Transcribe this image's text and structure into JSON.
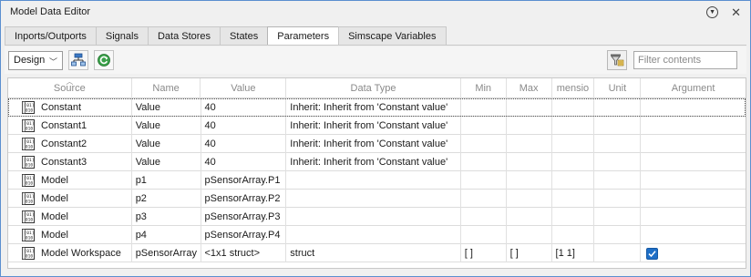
{
  "window": {
    "title": "Model Data Editor",
    "menu_icon": "circle-chevron-down-icon",
    "close_icon": "close-icon"
  },
  "tabs": [
    {
      "label": "Inports/Outports",
      "active": false
    },
    {
      "label": "Signals",
      "active": false
    },
    {
      "label": "Data Stores",
      "active": false
    },
    {
      "label": "States",
      "active": false
    },
    {
      "label": "Parameters",
      "active": true
    },
    {
      "label": "Simscape Variables",
      "active": false
    }
  ],
  "toolbar": {
    "view_select": "Design",
    "hierarchy_icon": "model-hierarchy-icon",
    "refresh_icon": "refresh-icon",
    "filter_icon": "filter-icon",
    "filter_placeholder": "Filter contents"
  },
  "columns": [
    "Source",
    "Name",
    "Value",
    "Data Type",
    "Min",
    "Max",
    "mensio",
    "Unit",
    "Argument"
  ],
  "rows": [
    {
      "source": "Constant",
      "name": "Value",
      "value": "40",
      "datatype": "Inherit: Inherit from 'Constant value'",
      "min": "",
      "max": "",
      "dim": "",
      "unit": "",
      "argument": false,
      "arg_shown": false,
      "selected": true
    },
    {
      "source": "Constant1",
      "name": "Value",
      "value": "40",
      "datatype": "Inherit: Inherit from 'Constant value'",
      "min": "",
      "max": "",
      "dim": "",
      "unit": "",
      "argument": false,
      "arg_shown": false,
      "selected": false
    },
    {
      "source": "Constant2",
      "name": "Value",
      "value": "40",
      "datatype": "Inherit: Inherit from 'Constant value'",
      "min": "",
      "max": "",
      "dim": "",
      "unit": "",
      "argument": false,
      "arg_shown": false,
      "selected": false
    },
    {
      "source": "Constant3",
      "name": "Value",
      "value": "40",
      "datatype": "Inherit: Inherit from 'Constant value'",
      "min": "",
      "max": "",
      "dim": "",
      "unit": "",
      "argument": false,
      "arg_shown": false,
      "selected": false
    },
    {
      "source": "Model",
      "name": "p1",
      "value": "pSensorArray.P1",
      "datatype": "",
      "min": "",
      "max": "",
      "dim": "",
      "unit": "",
      "argument": false,
      "arg_shown": false,
      "selected": false
    },
    {
      "source": "Model",
      "name": "p2",
      "value": "pSensorArray.P2",
      "datatype": "",
      "min": "",
      "max": "",
      "dim": "",
      "unit": "",
      "argument": false,
      "arg_shown": false,
      "selected": false
    },
    {
      "source": "Model",
      "name": "p3",
      "value": "pSensorArray.P3",
      "datatype": "",
      "min": "",
      "max": "",
      "dim": "",
      "unit": "",
      "argument": false,
      "arg_shown": false,
      "selected": false
    },
    {
      "source": "Model",
      "name": "p4",
      "value": "pSensorArray.P4",
      "datatype": "",
      "min": "",
      "max": "",
      "dim": "",
      "unit": "",
      "argument": false,
      "arg_shown": false,
      "selected": false
    },
    {
      "source": "Model Workspace",
      "name": "pSensorArray",
      "value": "<1x1 struct>",
      "datatype": "struct",
      "min": "[ ]",
      "max": "[ ]",
      "dim": "[1 1]",
      "unit": "",
      "argument": true,
      "arg_shown": true,
      "selected": false
    }
  ],
  "colors": {
    "accent": "#1e6fc7",
    "window_border": "#5b8fd0"
  }
}
